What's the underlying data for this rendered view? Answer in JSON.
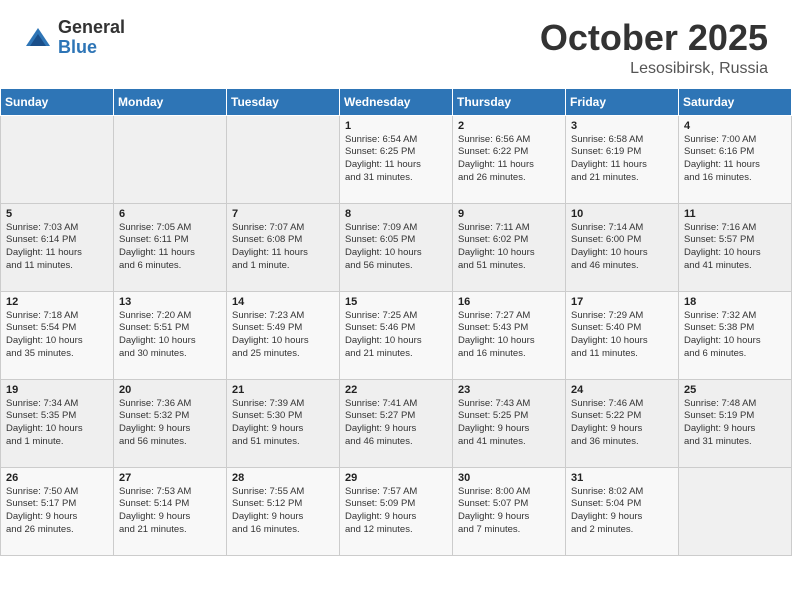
{
  "header": {
    "logo_general": "General",
    "logo_blue": "Blue",
    "month": "October 2025",
    "location": "Lesosibirsk, Russia"
  },
  "days_of_week": [
    "Sunday",
    "Monday",
    "Tuesday",
    "Wednesday",
    "Thursday",
    "Friday",
    "Saturday"
  ],
  "weeks": [
    [
      {
        "day": "",
        "info": ""
      },
      {
        "day": "",
        "info": ""
      },
      {
        "day": "",
        "info": ""
      },
      {
        "day": "1",
        "info": "Sunrise: 6:54 AM\nSunset: 6:25 PM\nDaylight: 11 hours\nand 31 minutes."
      },
      {
        "day": "2",
        "info": "Sunrise: 6:56 AM\nSunset: 6:22 PM\nDaylight: 11 hours\nand 26 minutes."
      },
      {
        "day": "3",
        "info": "Sunrise: 6:58 AM\nSunset: 6:19 PM\nDaylight: 11 hours\nand 21 minutes."
      },
      {
        "day": "4",
        "info": "Sunrise: 7:00 AM\nSunset: 6:16 PM\nDaylight: 11 hours\nand 16 minutes."
      }
    ],
    [
      {
        "day": "5",
        "info": "Sunrise: 7:03 AM\nSunset: 6:14 PM\nDaylight: 11 hours\nand 11 minutes."
      },
      {
        "day": "6",
        "info": "Sunrise: 7:05 AM\nSunset: 6:11 PM\nDaylight: 11 hours\nand 6 minutes."
      },
      {
        "day": "7",
        "info": "Sunrise: 7:07 AM\nSunset: 6:08 PM\nDaylight: 11 hours\nand 1 minute."
      },
      {
        "day": "8",
        "info": "Sunrise: 7:09 AM\nSunset: 6:05 PM\nDaylight: 10 hours\nand 56 minutes."
      },
      {
        "day": "9",
        "info": "Sunrise: 7:11 AM\nSunset: 6:02 PM\nDaylight: 10 hours\nand 51 minutes."
      },
      {
        "day": "10",
        "info": "Sunrise: 7:14 AM\nSunset: 6:00 PM\nDaylight: 10 hours\nand 46 minutes."
      },
      {
        "day": "11",
        "info": "Sunrise: 7:16 AM\nSunset: 5:57 PM\nDaylight: 10 hours\nand 41 minutes."
      }
    ],
    [
      {
        "day": "12",
        "info": "Sunrise: 7:18 AM\nSunset: 5:54 PM\nDaylight: 10 hours\nand 35 minutes."
      },
      {
        "day": "13",
        "info": "Sunrise: 7:20 AM\nSunset: 5:51 PM\nDaylight: 10 hours\nand 30 minutes."
      },
      {
        "day": "14",
        "info": "Sunrise: 7:23 AM\nSunset: 5:49 PM\nDaylight: 10 hours\nand 25 minutes."
      },
      {
        "day": "15",
        "info": "Sunrise: 7:25 AM\nSunset: 5:46 PM\nDaylight: 10 hours\nand 21 minutes."
      },
      {
        "day": "16",
        "info": "Sunrise: 7:27 AM\nSunset: 5:43 PM\nDaylight: 10 hours\nand 16 minutes."
      },
      {
        "day": "17",
        "info": "Sunrise: 7:29 AM\nSunset: 5:40 PM\nDaylight: 10 hours\nand 11 minutes."
      },
      {
        "day": "18",
        "info": "Sunrise: 7:32 AM\nSunset: 5:38 PM\nDaylight: 10 hours\nand 6 minutes."
      }
    ],
    [
      {
        "day": "19",
        "info": "Sunrise: 7:34 AM\nSunset: 5:35 PM\nDaylight: 10 hours\nand 1 minute."
      },
      {
        "day": "20",
        "info": "Sunrise: 7:36 AM\nSunset: 5:32 PM\nDaylight: 9 hours\nand 56 minutes."
      },
      {
        "day": "21",
        "info": "Sunrise: 7:39 AM\nSunset: 5:30 PM\nDaylight: 9 hours\nand 51 minutes."
      },
      {
        "day": "22",
        "info": "Sunrise: 7:41 AM\nSunset: 5:27 PM\nDaylight: 9 hours\nand 46 minutes."
      },
      {
        "day": "23",
        "info": "Sunrise: 7:43 AM\nSunset: 5:25 PM\nDaylight: 9 hours\nand 41 minutes."
      },
      {
        "day": "24",
        "info": "Sunrise: 7:46 AM\nSunset: 5:22 PM\nDaylight: 9 hours\nand 36 minutes."
      },
      {
        "day": "25",
        "info": "Sunrise: 7:48 AM\nSunset: 5:19 PM\nDaylight: 9 hours\nand 31 minutes."
      }
    ],
    [
      {
        "day": "26",
        "info": "Sunrise: 7:50 AM\nSunset: 5:17 PM\nDaylight: 9 hours\nand 26 minutes."
      },
      {
        "day": "27",
        "info": "Sunrise: 7:53 AM\nSunset: 5:14 PM\nDaylight: 9 hours\nand 21 minutes."
      },
      {
        "day": "28",
        "info": "Sunrise: 7:55 AM\nSunset: 5:12 PM\nDaylight: 9 hours\nand 16 minutes."
      },
      {
        "day": "29",
        "info": "Sunrise: 7:57 AM\nSunset: 5:09 PM\nDaylight: 9 hours\nand 12 minutes."
      },
      {
        "day": "30",
        "info": "Sunrise: 8:00 AM\nSunset: 5:07 PM\nDaylight: 9 hours\nand 7 minutes."
      },
      {
        "day": "31",
        "info": "Sunrise: 8:02 AM\nSunset: 5:04 PM\nDaylight: 9 hours\nand 2 minutes."
      },
      {
        "day": "",
        "info": ""
      }
    ]
  ]
}
